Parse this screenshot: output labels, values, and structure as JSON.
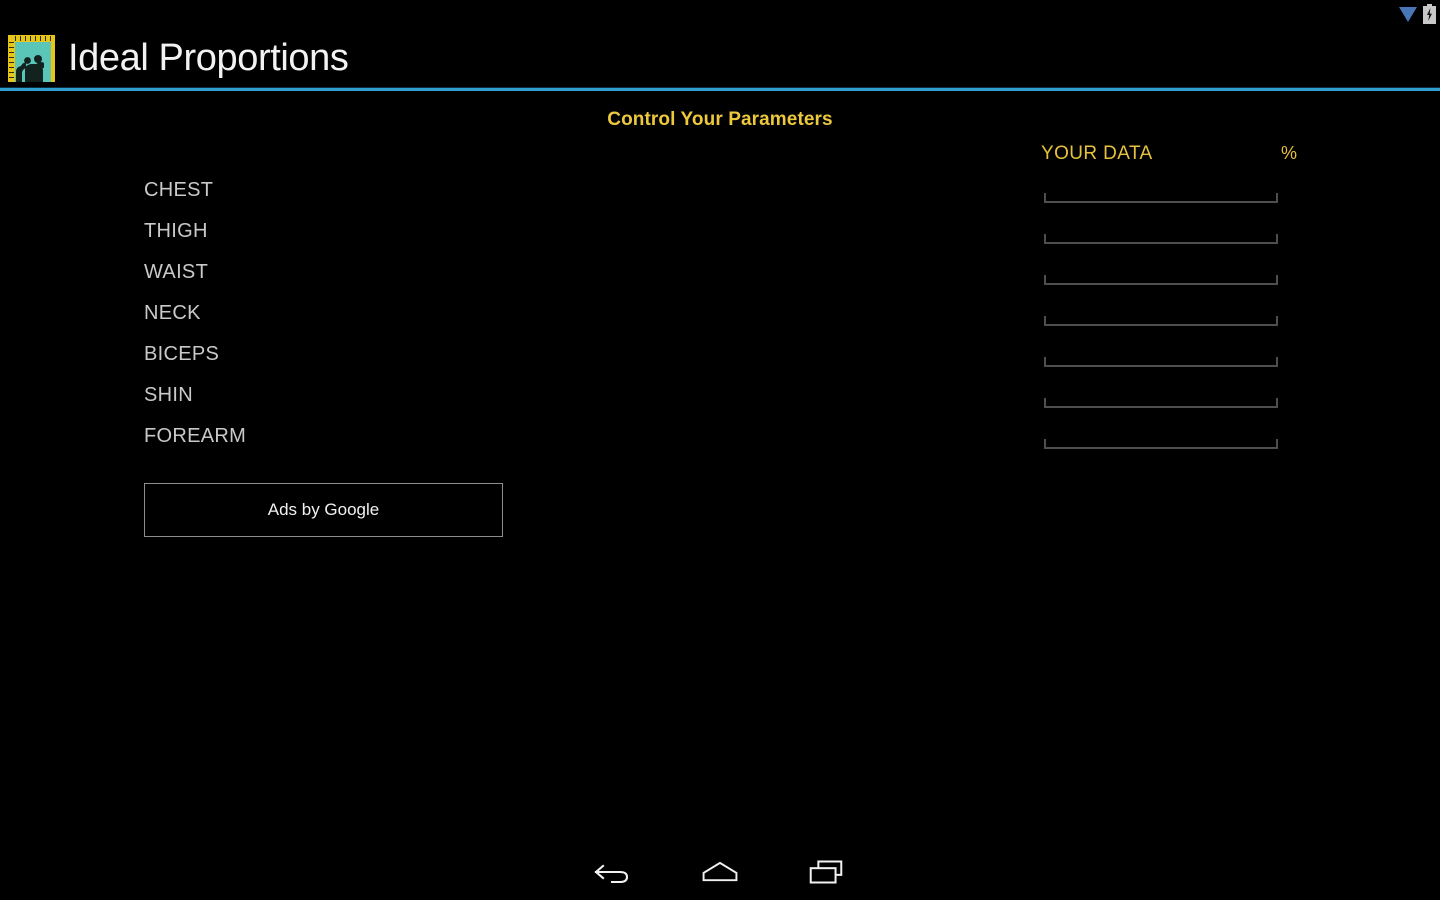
{
  "status_bar": {
    "icons": [
      {
        "name": "download-indicator-icon",
        "label": "download"
      },
      {
        "name": "battery-charging-icon",
        "label": "battery charging"
      }
    ]
  },
  "action_bar": {
    "app_icon": "app-logo-icon",
    "title": "Ideal Proportions",
    "divider_color": "#33b5e5"
  },
  "content": {
    "section_title": "Control Your Parameters",
    "data_column_header": "YOUR DATA",
    "unit_header": "%",
    "parameters": [
      {
        "label": "CHEST",
        "value": "",
        "placeholder": ""
      },
      {
        "label": "THIGH",
        "value": "",
        "placeholder": ""
      },
      {
        "label": "WAIST",
        "value": "",
        "placeholder": ""
      },
      {
        "label": "NECK",
        "value": "",
        "placeholder": ""
      },
      {
        "label": "BICEPS",
        "value": "",
        "placeholder": ""
      },
      {
        "label": "SHIN",
        "value": "",
        "placeholder": ""
      },
      {
        "label": "FOREARM",
        "value": "",
        "placeholder": ""
      }
    ],
    "ad": {
      "label": "Ads by Google"
    }
  },
  "nav_bar": {
    "back_label": "Back",
    "home_label": "Home",
    "recents_label": "Recent apps"
  },
  "colors": {
    "background": "#000000",
    "accent_gold": "#ecc83c",
    "holo_blue": "#33b5e5",
    "label_gray": "#c9c9c9",
    "underline_gray": "#4e4e4e"
  }
}
